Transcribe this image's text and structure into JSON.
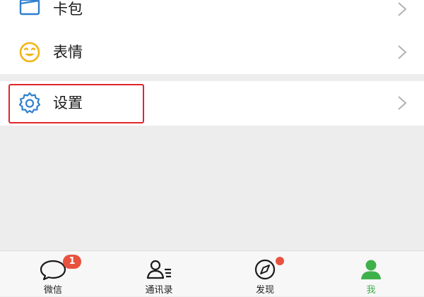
{
  "menu": {
    "items": [
      {
        "label": "卡包",
        "icon": "card-wallet-icon"
      },
      {
        "label": "表情",
        "icon": "smiley-sticker-icon"
      },
      {
        "label": "设置",
        "icon": "gear-icon"
      }
    ]
  },
  "highlight": {
    "color": "#e0262b"
  },
  "tabbar": {
    "tabs": [
      {
        "label": "微信",
        "icon": "chat-bubble-icon",
        "badge": "1"
      },
      {
        "label": "通讯录",
        "icon": "contacts-icon"
      },
      {
        "label": "发现",
        "icon": "compass-icon",
        "dot": true
      },
      {
        "label": "我",
        "icon": "person-icon",
        "active": true
      }
    ],
    "active_color": "#3fb14a",
    "badge_color": "#e8523f"
  }
}
